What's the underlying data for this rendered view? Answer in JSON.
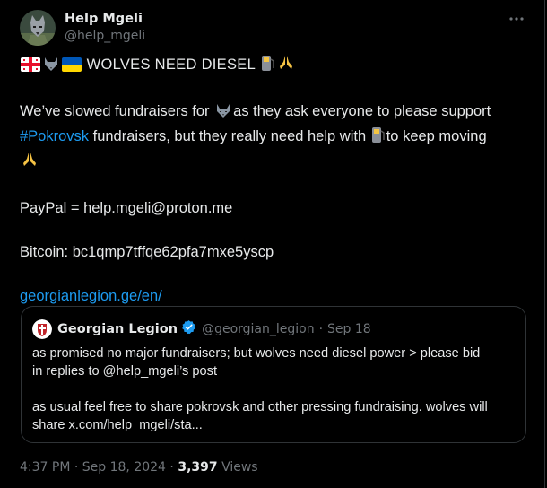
{
  "author": {
    "display_name": "Help Mgeli",
    "handle": "@help_mgeli"
  },
  "tweet": {
    "flags": [
      "georgia-flag",
      "wolf-emoji",
      "ukraine-flag"
    ],
    "title": "WOLVES  NEED  DIESEL",
    "line1_a": "We’ve slowed fundraisers for",
    "line1_b": "as they ask everyone  to  please support",
    "hashtag": "#Pokrovsk",
    "line2_b": " fundraisers, but they really need help with",
    "line2_c": "to keep moving",
    "paypal": "PayPal = help.mgeli@proton.me",
    "bitcoin": "Bitcoin: bc1qmp7tffqe62pfa7mxe5yscp",
    "link": "georgianlegion.ge/en/"
  },
  "quote": {
    "display_name": "Georgian Legion",
    "handle": "@georgian_legion",
    "separator": "·",
    "date": "Sep 18",
    "line1": "as promised no major fundraisers; but wolves need diesel power > please bid",
    "line2": "in replies to @help_mgeli’s post",
    "line3": "as usual feel free to share pokrovsk and other pressing fundraising. wolves will",
    "line4": "share x.com/help_mgeli/sta..."
  },
  "footer": {
    "time": "4:37 PM",
    "dot1": "·",
    "date": "Sep 18, 2024",
    "dot2": "·",
    "views_count": "3,397",
    "views_label": "Views"
  },
  "colors": {
    "background": "#000000",
    "text": "#e7e9ea",
    "muted": "#71767b",
    "link": "#1d9bf0",
    "border": "#2f3336",
    "verified": "#1d9bf0"
  }
}
